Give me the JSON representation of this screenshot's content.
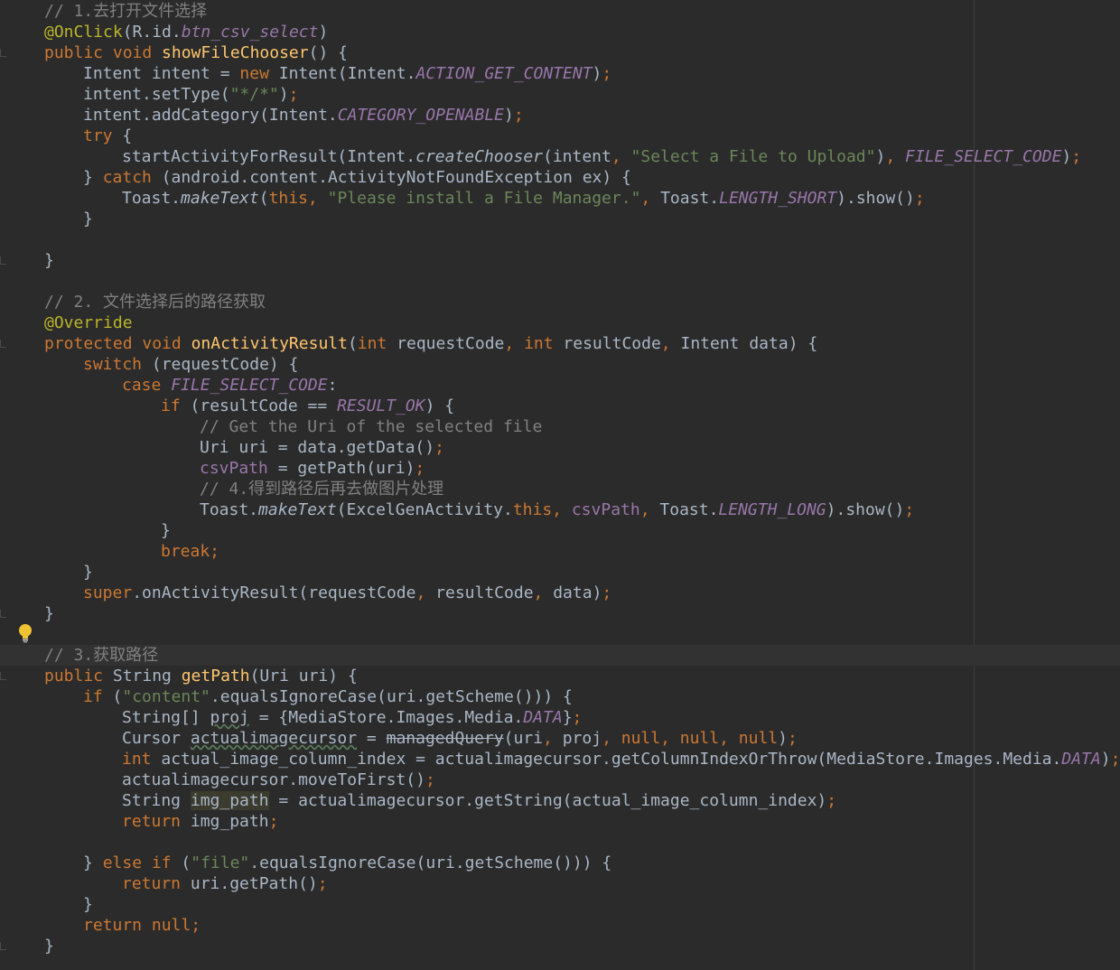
{
  "theme": {
    "background": "#2b2b2b",
    "default_text": "#a9b7c6",
    "keyword": "#cc7832",
    "string": "#6a8759",
    "comment": "#808080",
    "annotation": "#bbb529",
    "method_declaration": "#ffc66d",
    "field_constant": "#9876aa"
  },
  "gutter": {
    "intention_icon": "lightbulb-icon",
    "intention_line": 30
  },
  "lines": [
    {
      "indent": 1,
      "tokens": [
        {
          "t": "// 1.去打开文件选择",
          "c": "cm"
        }
      ]
    },
    {
      "indent": 1,
      "tokens": [
        {
          "t": "@OnClick",
          "c": "an"
        },
        {
          "t": "(R.id."
        },
        {
          "t": "btn_csv_select",
          "c": "fd"
        },
        {
          "t": ")"
        }
      ]
    },
    {
      "indent": 1,
      "mark": true,
      "tokens": [
        {
          "t": "public void ",
          "c": "kw"
        },
        {
          "t": "showFileChooser",
          "c": "fn"
        },
        {
          "t": "() {"
        }
      ]
    },
    {
      "indent": 2,
      "tokens": [
        {
          "t": "Intent intent = "
        },
        {
          "t": "new ",
          "c": "kw"
        },
        {
          "t": "Intent(Intent."
        },
        {
          "t": "ACTION_GET_CONTENT",
          "c": "fd"
        },
        {
          "t": ")"
        },
        {
          "t": ";",
          "c": "kw"
        }
      ]
    },
    {
      "indent": 2,
      "tokens": [
        {
          "t": "intent.setType("
        },
        {
          "t": "\"*/*\"",
          "c": "str"
        },
        {
          "t": ")"
        },
        {
          "t": ";",
          "c": "kw"
        }
      ]
    },
    {
      "indent": 2,
      "tokens": [
        {
          "t": "intent.addCategory(Intent."
        },
        {
          "t": "CATEGORY_OPENABLE",
          "c": "fd"
        },
        {
          "t": ")"
        },
        {
          "t": ";",
          "c": "kw"
        }
      ]
    },
    {
      "indent": 2,
      "tokens": [
        {
          "t": "try ",
          "c": "kw"
        },
        {
          "t": "{"
        }
      ]
    },
    {
      "indent": 3,
      "tokens": [
        {
          "t": "startActivityForResult(Intent."
        },
        {
          "t": "createChooser",
          "c": "it"
        },
        {
          "t": "(intent"
        },
        {
          "t": ", ",
          "c": "kw"
        },
        {
          "t": "\"Select a File to Upload\"",
          "c": "str"
        },
        {
          "t": ")"
        },
        {
          "t": ", ",
          "c": "kw"
        },
        {
          "t": "FILE_SELECT_CODE",
          "c": "fd"
        },
        {
          "t": ")"
        },
        {
          "t": ";",
          "c": "kw"
        }
      ]
    },
    {
      "indent": 2,
      "tokens": [
        {
          "t": "} "
        },
        {
          "t": "catch ",
          "c": "kw"
        },
        {
          "t": "(android.content.ActivityNotFoundException ex) {"
        }
      ]
    },
    {
      "indent": 3,
      "tokens": [
        {
          "t": "Toast."
        },
        {
          "t": "makeText",
          "c": "it"
        },
        {
          "t": "("
        },
        {
          "t": "this, ",
          "c": "kw"
        },
        {
          "t": "\"Please install a File Manager.\"",
          "c": "str"
        },
        {
          "t": ", ",
          "c": "kw"
        },
        {
          "t": "Toast."
        },
        {
          "t": "LENGTH_SHORT",
          "c": "fd"
        },
        {
          "t": ").show()"
        },
        {
          "t": ";",
          "c": "kw"
        }
      ]
    },
    {
      "indent": 2,
      "tokens": [
        {
          "t": "}"
        }
      ]
    },
    {
      "indent": 0,
      "tokens": []
    },
    {
      "indent": 1,
      "mark": true,
      "tokens": [
        {
          "t": "}"
        }
      ]
    },
    {
      "indent": 0,
      "tokens": []
    },
    {
      "indent": 1,
      "tokens": [
        {
          "t": "// 2. 文件选择后的路径获取",
          "c": "cm"
        }
      ]
    },
    {
      "indent": 1,
      "tokens": [
        {
          "t": "@Override",
          "c": "an"
        }
      ]
    },
    {
      "indent": 1,
      "mark": true,
      "tokens": [
        {
          "t": "protected void ",
          "c": "kw"
        },
        {
          "t": "onActivityResult",
          "c": "fn"
        },
        {
          "t": "("
        },
        {
          "t": "int ",
          "c": "kw"
        },
        {
          "t": "requestCode"
        },
        {
          "t": ", ",
          "c": "kw"
        },
        {
          "t": "int ",
          "c": "kw"
        },
        {
          "t": "resultCode"
        },
        {
          "t": ", ",
          "c": "kw"
        },
        {
          "t": "Intent data) {"
        }
      ]
    },
    {
      "indent": 2,
      "tokens": [
        {
          "t": "switch ",
          "c": "kw"
        },
        {
          "t": "(requestCode) {"
        }
      ]
    },
    {
      "indent": 3,
      "tokens": [
        {
          "t": "case ",
          "c": "kw"
        },
        {
          "t": "FILE_SELECT_CODE",
          "c": "fd"
        },
        {
          "t": ":"
        }
      ]
    },
    {
      "indent": 4,
      "tokens": [
        {
          "t": "if ",
          "c": "kw"
        },
        {
          "t": "(resultCode == "
        },
        {
          "t": "RESULT_OK",
          "c": "fd"
        },
        {
          "t": ") {"
        }
      ]
    },
    {
      "indent": 5,
      "tokens": [
        {
          "t": "// Get the Uri of the selected file",
          "c": "cm"
        }
      ]
    },
    {
      "indent": 5,
      "tokens": [
        {
          "t": "Uri uri = data.getData()"
        },
        {
          "t": ";",
          "c": "kw"
        }
      ]
    },
    {
      "indent": 5,
      "tokens": [
        {
          "t": "csvPath",
          "c": "fdn"
        },
        {
          "t": " = getPath(uri)"
        },
        {
          "t": ";",
          "c": "kw"
        }
      ]
    },
    {
      "indent": 5,
      "tokens": [
        {
          "t": "// 4.得到路径后再去做图片处理",
          "c": "cm"
        }
      ]
    },
    {
      "indent": 5,
      "tokens": [
        {
          "t": "Toast."
        },
        {
          "t": "makeText",
          "c": "it"
        },
        {
          "t": "(ExcelGenActivity."
        },
        {
          "t": "this, ",
          "c": "kw"
        },
        {
          "t": "csvPath",
          "c": "fdn"
        },
        {
          "t": ", ",
          "c": "kw"
        },
        {
          "t": "Toast."
        },
        {
          "t": "LENGTH_LONG",
          "c": "fd"
        },
        {
          "t": ").show()"
        },
        {
          "t": ";",
          "c": "kw"
        }
      ]
    },
    {
      "indent": 4,
      "tokens": [
        {
          "t": "}"
        }
      ]
    },
    {
      "indent": 4,
      "tokens": [
        {
          "t": "break;",
          "c": "kw"
        }
      ]
    },
    {
      "indent": 2,
      "tokens": [
        {
          "t": "}"
        }
      ]
    },
    {
      "indent": 2,
      "tokens": [
        {
          "t": "super",
          "c": "kw"
        },
        {
          "t": ".onActivityResult(requestCode"
        },
        {
          "t": ", ",
          "c": "kw"
        },
        {
          "t": "resultCode"
        },
        {
          "t": ", ",
          "c": "kw"
        },
        {
          "t": "data)"
        },
        {
          "t": ";",
          "c": "kw"
        }
      ]
    },
    {
      "indent": 1,
      "mark": true,
      "tokens": [
        {
          "t": "}"
        }
      ]
    },
    {
      "indent": 0,
      "tokens": []
    },
    {
      "indent": 1,
      "current": true,
      "tokens": [
        {
          "t": "// 3.获取路径",
          "c": "cm"
        }
      ]
    },
    {
      "indent": 1,
      "mark": true,
      "tokens": [
        {
          "t": "public ",
          "c": "kw"
        },
        {
          "t": "String "
        },
        {
          "t": "getPath",
          "c": "fn"
        },
        {
          "t": "(Uri uri) {"
        }
      ]
    },
    {
      "indent": 2,
      "tokens": [
        {
          "t": "if ",
          "c": "kw"
        },
        {
          "t": "("
        },
        {
          "t": "\"content\"",
          "c": "str"
        },
        {
          "t": ".equalsIgnoreCase(uri.getScheme())) {"
        }
      ]
    },
    {
      "indent": 3,
      "tokens": [
        {
          "t": "String[] "
        },
        {
          "t": "proj",
          "c": "sg"
        },
        {
          "t": " = {MediaStore.Images.Media."
        },
        {
          "t": "DATA",
          "c": "fd"
        },
        {
          "t": "}"
        },
        {
          "t": ";",
          "c": "kw"
        }
      ]
    },
    {
      "indent": 3,
      "tokens": [
        {
          "t": "Cursor "
        },
        {
          "t": "actualimagecursor",
          "c": "sg"
        },
        {
          "t": " = "
        },
        {
          "t": "managedQuery",
          "c": "st"
        },
        {
          "t": "(uri"
        },
        {
          "t": ", ",
          "c": "kw"
        },
        {
          "t": "proj"
        },
        {
          "t": ", null, null, null",
          "c": "kw"
        },
        {
          "t": ")"
        },
        {
          "t": ";",
          "c": "kw"
        }
      ]
    },
    {
      "indent": 3,
      "tokens": [
        {
          "t": "int ",
          "c": "kw"
        },
        {
          "t": "actual_image_column_index = actualimagecursor.getColumnIndexOrThrow(MediaStore.Images.Media."
        },
        {
          "t": "DATA",
          "c": "fd"
        },
        {
          "t": ")"
        },
        {
          "t": ";",
          "c": "kw"
        }
      ]
    },
    {
      "indent": 3,
      "tokens": [
        {
          "t": "actualimagecursor.moveToFirst()"
        },
        {
          "t": ";",
          "c": "kw"
        }
      ]
    },
    {
      "indent": 3,
      "tokens": [
        {
          "t": "String "
        },
        {
          "t": "img_path",
          "c": "hl"
        },
        {
          "t": " = actualimagecursor.getString(actual_image_column_index)"
        },
        {
          "t": ";",
          "c": "kw"
        }
      ]
    },
    {
      "indent": 3,
      "tokens": [
        {
          "t": "return ",
          "c": "kw"
        },
        {
          "t": "img_path"
        },
        {
          "t": ";",
          "c": "kw"
        }
      ]
    },
    {
      "indent": 0,
      "tokens": []
    },
    {
      "indent": 2,
      "tokens": [
        {
          "t": "} "
        },
        {
          "t": "else if ",
          "c": "kw"
        },
        {
          "t": "("
        },
        {
          "t": "\"file\"",
          "c": "str"
        },
        {
          "t": ".equalsIgnoreCase(uri.getScheme())) {"
        }
      ]
    },
    {
      "indent": 3,
      "tokens": [
        {
          "t": "return ",
          "c": "kw"
        },
        {
          "t": "uri.getPath()"
        },
        {
          "t": ";",
          "c": "kw"
        }
      ]
    },
    {
      "indent": 2,
      "tokens": [
        {
          "t": "}"
        }
      ]
    },
    {
      "indent": 2,
      "tokens": [
        {
          "t": "return null;",
          "c": "kw"
        }
      ]
    },
    {
      "indent": 1,
      "mark": true,
      "tokens": [
        {
          "t": "}"
        }
      ]
    }
  ]
}
